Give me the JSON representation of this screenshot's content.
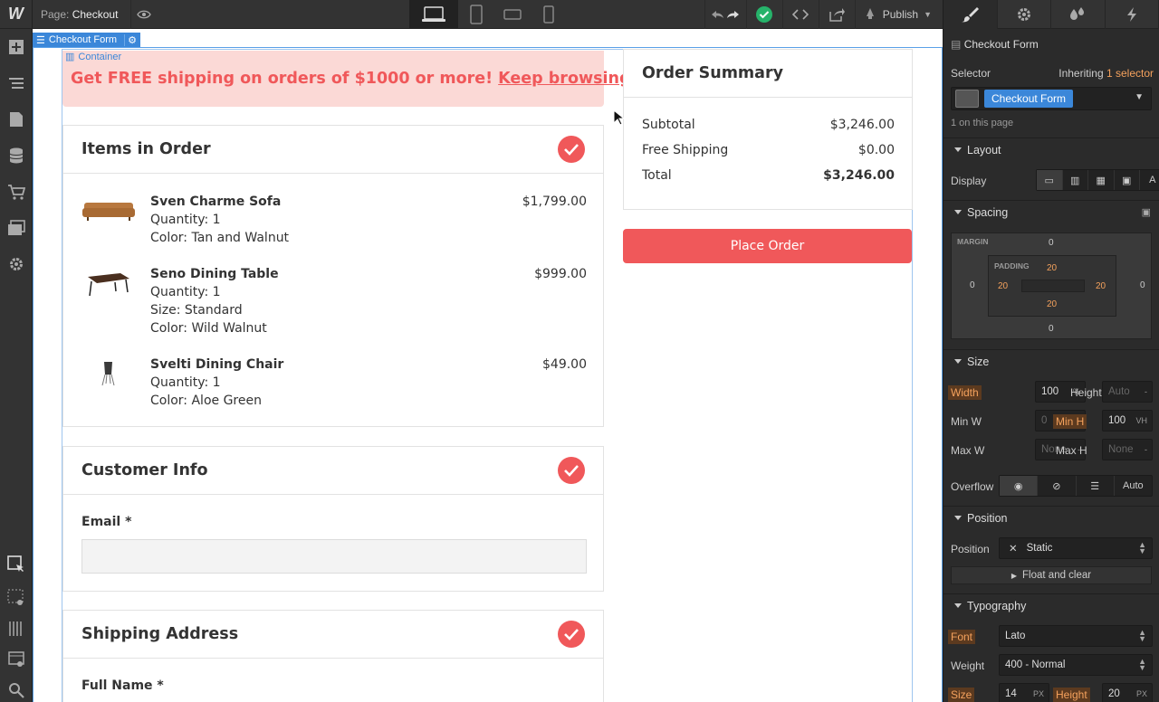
{
  "topbar": {
    "logo": "W",
    "page_prefix": "Page:",
    "page_name": "Checkout",
    "publish_label": "Publish"
  },
  "canvas": {
    "selected_tag": "Checkout Form",
    "container_tag": "Container",
    "banner": {
      "text": "Get FREE shipping on orders of $1000 or more!",
      "link": "Keep browsing →"
    },
    "items_card": {
      "title": "Items in Order",
      "items": [
        {
          "name": "Sven Charme Sofa",
          "price": "$1,799.00",
          "lines": [
            "Quantity:  1",
            "Color: Tan and Walnut"
          ]
        },
        {
          "name": "Seno Dining Table",
          "price": "$999.00",
          "lines": [
            "Quantity:  1",
            "Size: Standard",
            "Color: Wild Walnut"
          ]
        },
        {
          "name": "Svelti Dining Chair",
          "price": "$49.00",
          "lines": [
            "Quantity:  1",
            "Color: Aloe Green"
          ]
        }
      ]
    },
    "customer_card": {
      "title": "Customer Info",
      "email_label": "Email *"
    },
    "shipping_card": {
      "title": "Shipping Address",
      "fullname_label": "Full Name *"
    },
    "summary": {
      "title": "Order Summary",
      "rows": [
        {
          "label": "Subtotal",
          "value": "$3,246.00"
        },
        {
          "label": "Free Shipping",
          "value": "$0.00"
        },
        {
          "label": "Total",
          "value": "$3,246.00"
        }
      ],
      "place_order": "Place Order"
    }
  },
  "panel": {
    "element_name": "Checkout Form",
    "selector_label": "Selector",
    "inheriting_prefix": "Inheriting",
    "inheriting_count": "1 selector",
    "selector_chip": "Checkout Form",
    "on_page": "1 on this page",
    "layout": {
      "title": "Layout",
      "display_label": "Display"
    },
    "spacing": {
      "title": "Spacing",
      "margin_label": "MARGIN",
      "padding_label": "PADDING",
      "margin": {
        "top": "0",
        "right": "0",
        "bottom": "0",
        "left": "0"
      },
      "padding": {
        "top": "20",
        "right": "20",
        "bottom": "20",
        "left": "20"
      }
    },
    "size": {
      "title": "Size",
      "width_label": "Width",
      "width_value": "100",
      "width_unit": "%",
      "height_label": "Height",
      "height_value": "Auto",
      "height_unit": "-",
      "minw_label": "Min W",
      "minw_value": "0",
      "minw_unit": "PX",
      "minh_label": "Min H",
      "minh_value": "100",
      "minh_unit": "VH",
      "maxw_label": "Max W",
      "maxw_value": "None",
      "maxw_unit": "-",
      "maxh_label": "Max H",
      "maxh_value": "None",
      "maxh_unit": "-",
      "overflow_label": "Overflow",
      "overflow_auto": "Auto"
    },
    "position": {
      "title": "Position",
      "label": "Position",
      "value": "Static",
      "float_label": "Float and clear"
    },
    "typography": {
      "title": "Typography",
      "font_label": "Font",
      "font_value": "Lato",
      "weight_label": "Weight",
      "weight_value": "400 - Normal",
      "size_label": "Size",
      "size_value": "14",
      "size_unit": "PX",
      "height_label": "Height",
      "height_value": "20",
      "height_unit": "PX"
    }
  },
  "colors": {
    "accent": "#f0585a",
    "banner_bg": "#fbd9d6",
    "selection": "#3b87d9",
    "publish_ok": "#26b36a"
  }
}
